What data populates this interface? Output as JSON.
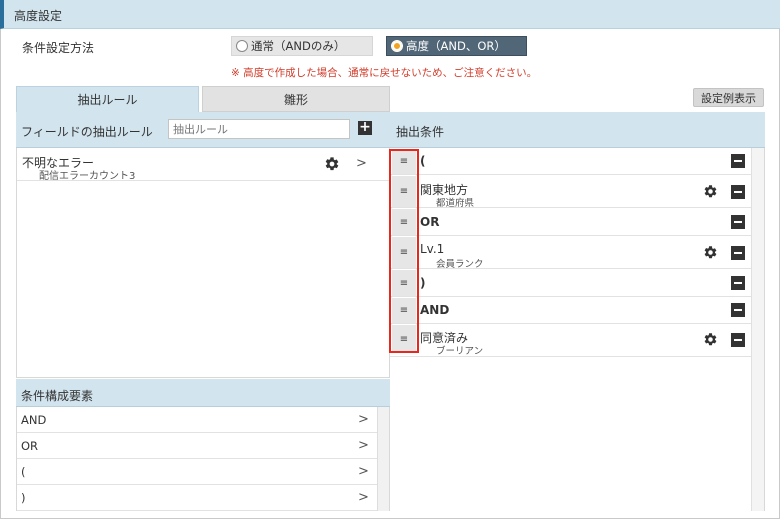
{
  "title": "高度設定",
  "mode": {
    "label": "条件設定方法",
    "option_normal": "通常（ANDのみ）",
    "option_advanced": "高度（AND、OR）",
    "selected": "advanced",
    "warning": "※ 高度で作成した場合、通常に戻せないため、ご注意ください。"
  },
  "tabs": {
    "extract_rules": "抽出ルール",
    "template": "雛形"
  },
  "example_button": "設定例表示",
  "field_rules": {
    "header": "フィールドの抽出ルール",
    "search_placeholder": "抽出ルール",
    "items": [
      {
        "name": "不明なエラー",
        "sub": "配信エラーカウント3"
      }
    ]
  },
  "elements": {
    "header": "条件構成要素",
    "items": [
      "AND",
      "OR",
      "(",
      ")"
    ]
  },
  "conditions": {
    "header": "抽出条件",
    "rows": [
      {
        "text": "(",
        "sub": ""
      },
      {
        "text": "関東地方",
        "sub": "都道府県"
      },
      {
        "text": "OR",
        "sub": ""
      },
      {
        "text": "Lv.1",
        "sub": "会員ランク"
      },
      {
        "text": ")",
        "sub": ""
      },
      {
        "text": "AND",
        "sub": ""
      },
      {
        "text": "同意済み",
        "sub": "ブーリアン"
      }
    ]
  },
  "icons": {
    "handle": "drag-handle-icon",
    "gear": "gear-icon",
    "minus": "remove-icon",
    "plus": "add-icon",
    "chevron": "chevron-right-icon"
  },
  "colors": {
    "header_bg": "#d2e4ee",
    "selected_option_bg": "#516677",
    "radio_on": "#f0a422",
    "warning": "#d23c2a",
    "highlight_border": "#e8281e"
  }
}
